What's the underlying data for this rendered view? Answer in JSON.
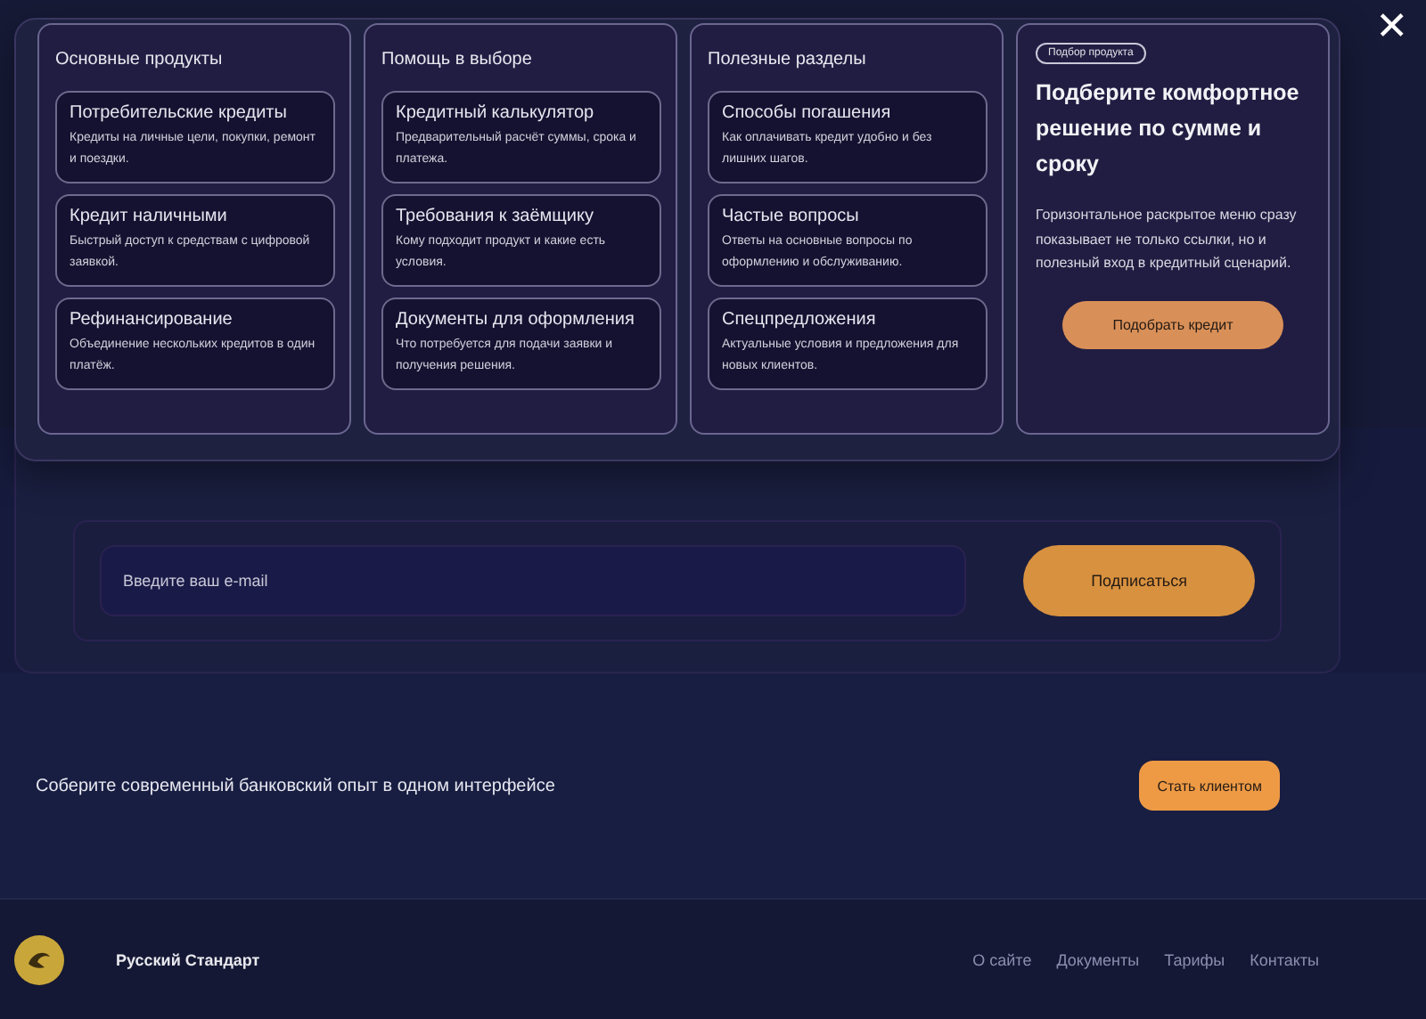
{
  "menu": {
    "columns": [
      {
        "title": "Основные продукты",
        "items": [
          {
            "title": "Потребительские кредиты",
            "description": "Кредиты на личные цели, покупки, ремонт и поездки."
          },
          {
            "title": "Кредит наличными",
            "description": "Быстрый доступ к средствам с цифровой заявкой."
          },
          {
            "title": "Рефинансирование",
            "description": "Объединение нескольких кредитов в один платёж."
          }
        ]
      },
      {
        "title": "Помощь в выборе",
        "items": [
          {
            "title": "Кредитный калькулятор",
            "description": "Предварительный расчёт суммы, срока и платежа."
          },
          {
            "title": "Требования к заёмщику",
            "description": "Кому подходит продукт и какие есть условия."
          },
          {
            "title": "Документы для оформления",
            "description": "Что потребуется для подачи заявки и получения решения."
          }
        ]
      },
      {
        "title": "Полезные разделы",
        "items": [
          {
            "title": "Способы погашения",
            "description": "Как оплачивать кредит удобно и без лишних шагов."
          },
          {
            "title": "Частые вопросы",
            "description": "Ответы на основные вопросы по оформлению и обслуживанию."
          },
          {
            "title": "Спецпредложения",
            "description": "Актуальные условия и предложения для новых клиентов."
          }
        ]
      }
    ],
    "promo": {
      "badge": "Подбор продукта",
      "title": "Подберите комфортное решение по сумме и сроку",
      "text": "Горизонтальное раскрытое меню сразу показывает не только ссылки, но и полезный вход в кредитный сценарий.",
      "button": "Подобрать кредит"
    },
    "close": "✕"
  },
  "subscribe": {
    "placeholder": "Введите ваш e-mail",
    "button": "Подписаться"
  },
  "cta": {
    "text": "Соберите современный банковский опыт в одном интерфейсе",
    "button": "Стать клиентом"
  },
  "footer": {
    "brand": "Русский Стандарт",
    "links": [
      "О сайте",
      "Документы",
      "Тарифы",
      "Контакты"
    ]
  }
}
